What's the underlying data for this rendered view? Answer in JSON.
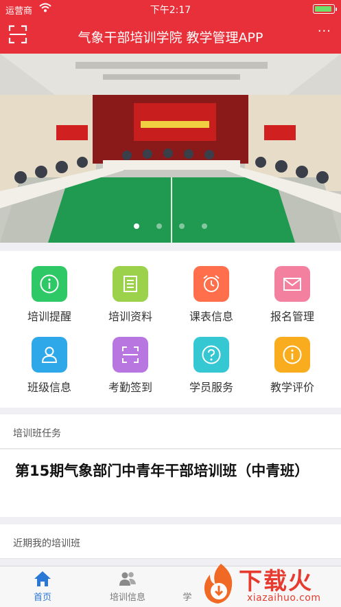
{
  "status_bar": {
    "carrier": "运营商",
    "time": "下午2:17"
  },
  "nav": {
    "title": "气象干部培训学院 教学管理APP",
    "more": "···"
  },
  "banner": {
    "slide_count": 4,
    "active_index": 0
  },
  "grid": [
    {
      "label": "培训提醒",
      "icon": "info-icon",
      "color": "#2ec866"
    },
    {
      "label": "培训资料",
      "icon": "document-icon",
      "color": "#9bd14b"
    },
    {
      "label": "课表信息",
      "icon": "alarm-clock-icon",
      "color": "#ff6f4b"
    },
    {
      "label": "报名管理",
      "icon": "mail-icon",
      "color": "#f2809e"
    },
    {
      "label": "班级信息",
      "icon": "person-icon",
      "color": "#2ea8e8"
    },
    {
      "label": "考勤签到",
      "icon": "scan-icon",
      "color": "#b877e0"
    },
    {
      "label": "学员服务",
      "icon": "question-icon",
      "color": "#36c8d2"
    },
    {
      "label": "教学评价",
      "icon": "info-icon",
      "color": "#f9ad1e"
    }
  ],
  "sections": {
    "tasks_header": "培训班任务",
    "task_title": "第15期气象部门中青年干部培训班（中青班）",
    "recent_header": "近期我的培训班"
  },
  "tabbar": [
    {
      "label": "首页",
      "icon": "home-icon",
      "active": true
    },
    {
      "label": "培训信息",
      "icon": "people-icon",
      "active": false
    },
    {
      "label": "学",
      "icon": "",
      "active": false
    }
  ],
  "watermark": {
    "cn": "下载火",
    "url": "xiazaihuo.com"
  },
  "colors": {
    "brand_red": "#e8303a",
    "tab_active": "#2a78d6"
  }
}
